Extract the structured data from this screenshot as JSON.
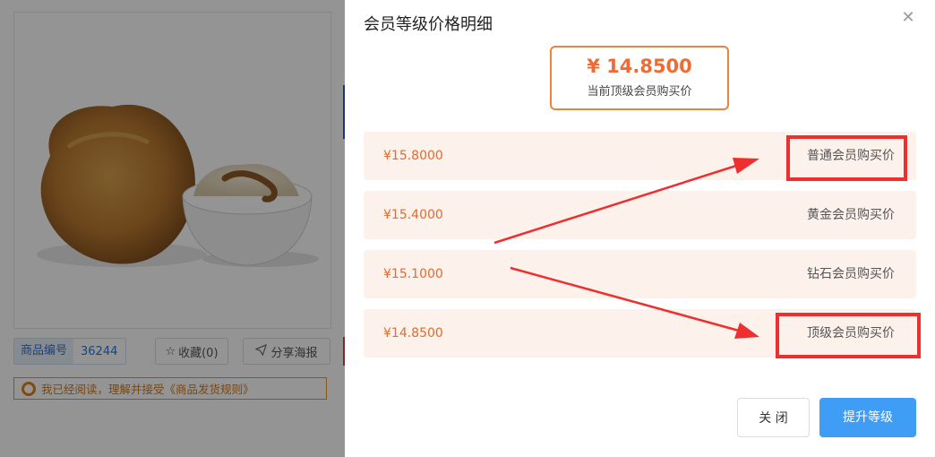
{
  "background_page": {
    "sku_label": "商品编号",
    "sku_value": "36244",
    "favorite_label": "收藏(0)",
    "share_label": "分享海报",
    "agreement_text": "我已经阅读，理解并接受《商品发货规则》"
  },
  "drawer": {
    "title": "会员等级价格明细",
    "top_price": {
      "value": "¥ 14.8500",
      "label": "当前顶级会员购买价"
    },
    "levels": [
      {
        "price": "¥15.8000",
        "name": "普通会员购买价"
      },
      {
        "price": "¥15.4000",
        "name": "黄金会员购买价"
      },
      {
        "price": "¥15.1000",
        "name": "钻石会员购买价"
      },
      {
        "price": "¥14.8500",
        "name": "顶级会员购买价"
      }
    ],
    "buttons": {
      "close": "关 闭",
      "upgrade": "提升等级"
    }
  },
  "colors": {
    "accent_orange": "#e9843d",
    "price_text": "#e26b2e",
    "row_bg": "#fdf1ec",
    "primary_blue": "#3f9df5",
    "annotation_red": "#ee2f2f"
  },
  "icons": [
    "close-icon",
    "star-icon",
    "paper-plane-icon",
    "radio-icon"
  ]
}
